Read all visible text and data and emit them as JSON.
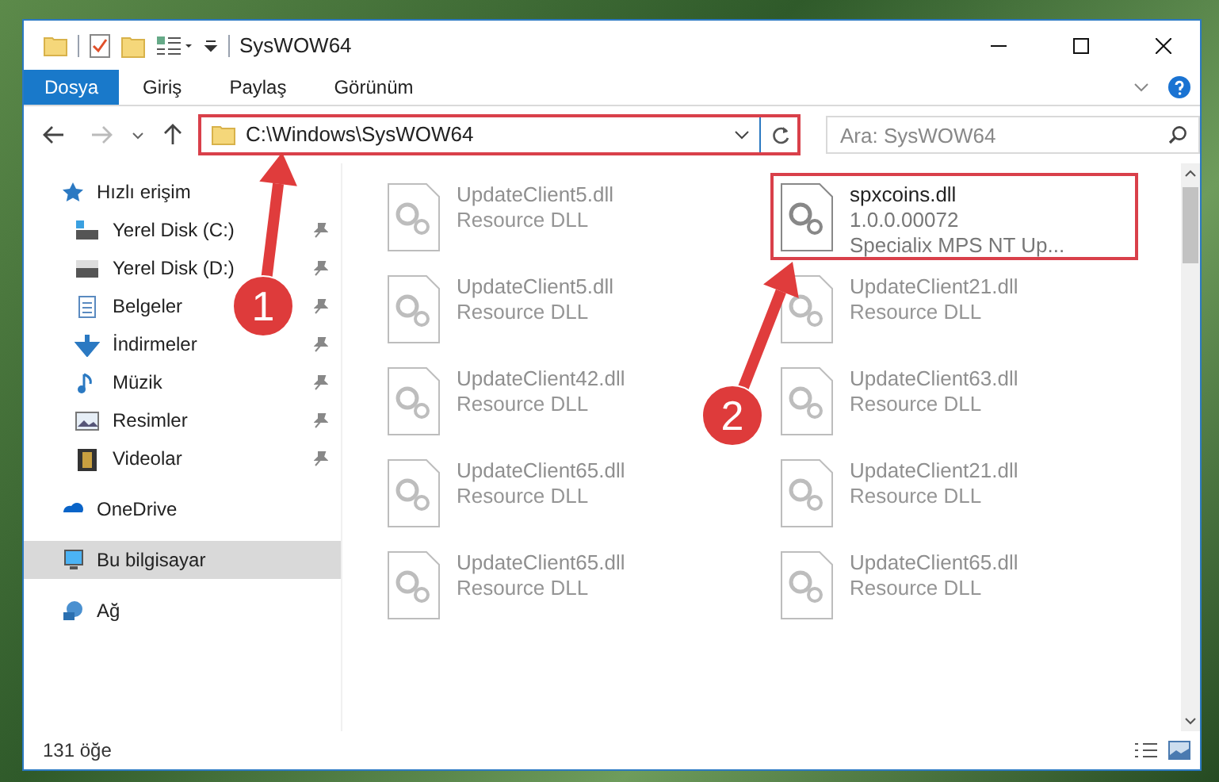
{
  "window": {
    "title": "SysWOW64"
  },
  "ribbon_tabs": [
    {
      "label": "Dosya",
      "selected": true
    },
    {
      "label": "Giriş",
      "selected": false
    },
    {
      "label": "Paylaş",
      "selected": false
    },
    {
      "label": "Görünüm",
      "selected": false
    }
  ],
  "address_bar": {
    "path": "C:\\Windows\\SysWOW64",
    "highlighted": true
  },
  "search": {
    "placeholder": "Ara: SysWOW64"
  },
  "nav_pane": [
    {
      "label": "Hızlı erişim",
      "selected": false,
      "children": [
        {
          "label": "Yerel Disk (C:)",
          "pinned": true
        },
        {
          "label": "Yerel Disk (D:)",
          "pinned": true
        },
        {
          "label": "Belgeler",
          "pinned": true
        },
        {
          "label": "İndirmeler",
          "pinned": true
        },
        {
          "label": "Müzik",
          "pinned": true
        },
        {
          "label": "Resimler",
          "pinned": true
        },
        {
          "label": "Videolar",
          "pinned": true
        }
      ]
    },
    {
      "label": "OneDrive",
      "selected": false
    },
    {
      "label": "Bu bilgisayar",
      "selected": true
    },
    {
      "label": "Ağ",
      "selected": false
    }
  ],
  "files": [
    {
      "name": "UpdateClient5.dll",
      "details": [
        "Resource DLL"
      ],
      "dimmed": true,
      "highlighted": false
    },
    {
      "name": "spxcoins.dll",
      "details": [
        "1.0.0.00072",
        "Specialix MPS NT Up..."
      ],
      "dimmed": false,
      "highlighted": true
    },
    {
      "name": "UpdateClient5.dll",
      "details": [
        "Resource DLL"
      ],
      "dimmed": true,
      "highlighted": false
    },
    {
      "name": "UpdateClient21.dll",
      "details": [
        "Resource DLL"
      ],
      "dimmed": true,
      "highlighted": false
    },
    {
      "name": "UpdateClient42.dll",
      "details": [
        "Resource DLL"
      ],
      "dimmed": true,
      "highlighted": false
    },
    {
      "name": "UpdateClient63.dll",
      "details": [
        "Resource DLL"
      ],
      "dimmed": true,
      "highlighted": false
    },
    {
      "name": "UpdateClient65.dll",
      "details": [
        "Resource DLL"
      ],
      "dimmed": true,
      "highlighted": false
    },
    {
      "name": "UpdateClient21.dll",
      "details": [
        "Resource DLL"
      ],
      "dimmed": true,
      "highlighted": false
    },
    {
      "name": "UpdateClient65.dll",
      "details": [
        "Resource DLL"
      ],
      "dimmed": true,
      "highlighted": false
    },
    {
      "name": "UpdateClient65.dll",
      "details": [
        "Resource DLL"
      ],
      "dimmed": true,
      "highlighted": false
    }
  ],
  "callouts": [
    {
      "number": "1"
    },
    {
      "number": "2"
    }
  ],
  "status_bar": {
    "item_count": "131 öğe"
  }
}
